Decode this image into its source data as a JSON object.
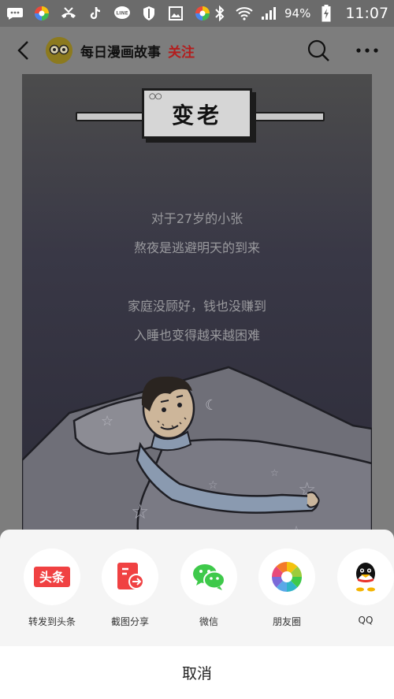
{
  "status_bar": {
    "battery_percent": "94%",
    "time": "11:07"
  },
  "header": {
    "account_name": "每日漫画故事",
    "follow_label": "关注"
  },
  "comic": {
    "title": "变老",
    "lines": [
      "对于27岁的小张",
      "熬夜是逃避明天的到来",
      "家庭没顾好，钱也没赚到",
      "入睡也变得越来越困难"
    ]
  },
  "share_sheet": {
    "items": [
      {
        "label": "转发到头条",
        "icon": "toutiao-icon",
        "icon_text": "头条",
        "color": "#f04142"
      },
      {
        "label": "截图分享",
        "icon": "screenshot-share-icon",
        "color": "#f04142"
      },
      {
        "label": "微信",
        "icon": "wechat-icon",
        "color": "#3ec94a"
      },
      {
        "label": "朋友圈",
        "icon": "moments-icon",
        "color": "#5aa8e8"
      },
      {
        "label": "QQ",
        "icon": "qq-icon",
        "color": "#111111"
      }
    ],
    "cancel_label": "取消"
  }
}
